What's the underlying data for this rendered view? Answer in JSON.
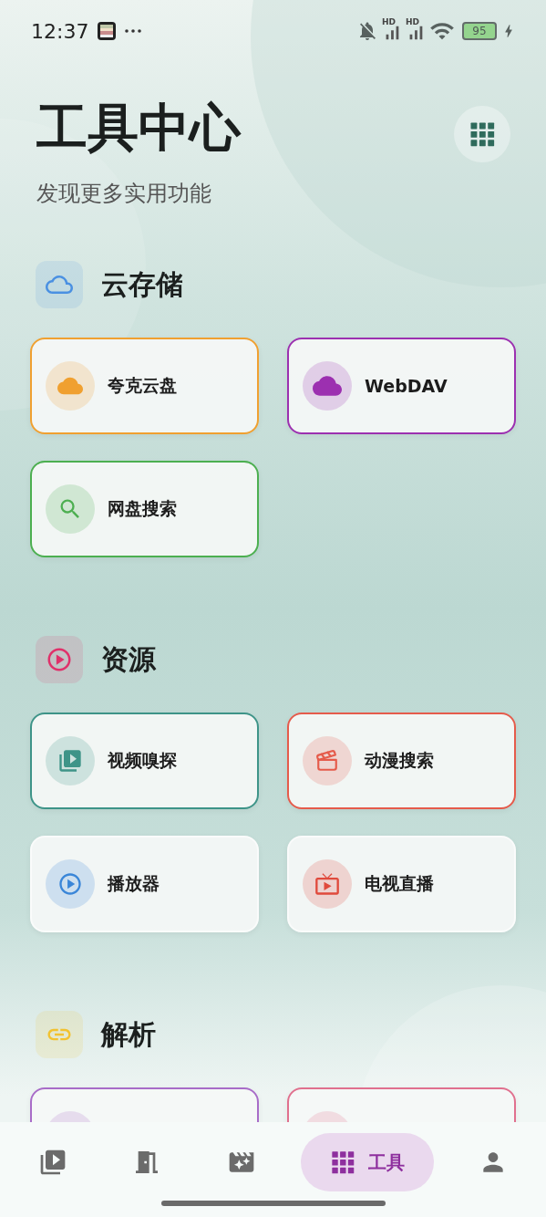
{
  "status_bar": {
    "time": "12:37",
    "network_labels": [
      "HD",
      "HD"
    ],
    "battery": "95"
  },
  "header": {
    "title": "工具中心",
    "subtitle": "发现更多实用功能"
  },
  "sections": [
    {
      "title": "云存储",
      "color": "#4a90e2",
      "items": [
        {
          "label": "夸克云盘",
          "color": "#f0a030",
          "bordered": true
        },
        {
          "label": "WebDAV",
          "color": "#9c30b0",
          "bordered": true
        },
        {
          "label": "网盘搜索",
          "color": "#4caf50",
          "bordered": true
        }
      ]
    },
    {
      "title": "资源",
      "color": "#e0306a",
      "items": [
        {
          "label": "视频嗅探",
          "color": "#3e9488",
          "bordered": true
        },
        {
          "label": "动漫搜索",
          "color": "#e55b4b",
          "bordered": true
        },
        {
          "label": "播放器",
          "color": "#3a86d8",
          "bordered": false
        },
        {
          "label": "电视直播",
          "color": "#e04a3c",
          "bordered": false
        }
      ]
    },
    {
      "title": "解析",
      "color": "#f2c230",
      "items": [
        {
          "color": "#a86cc8",
          "bordered": true
        },
        {
          "color": "#e0708e",
          "bordered": true
        }
      ]
    }
  ],
  "bottom_nav": [
    {
      "selected": false
    },
    {
      "selected": false
    },
    {
      "selected": false
    },
    {
      "selected": true,
      "label": "工具"
    },
    {
      "selected": false
    }
  ]
}
